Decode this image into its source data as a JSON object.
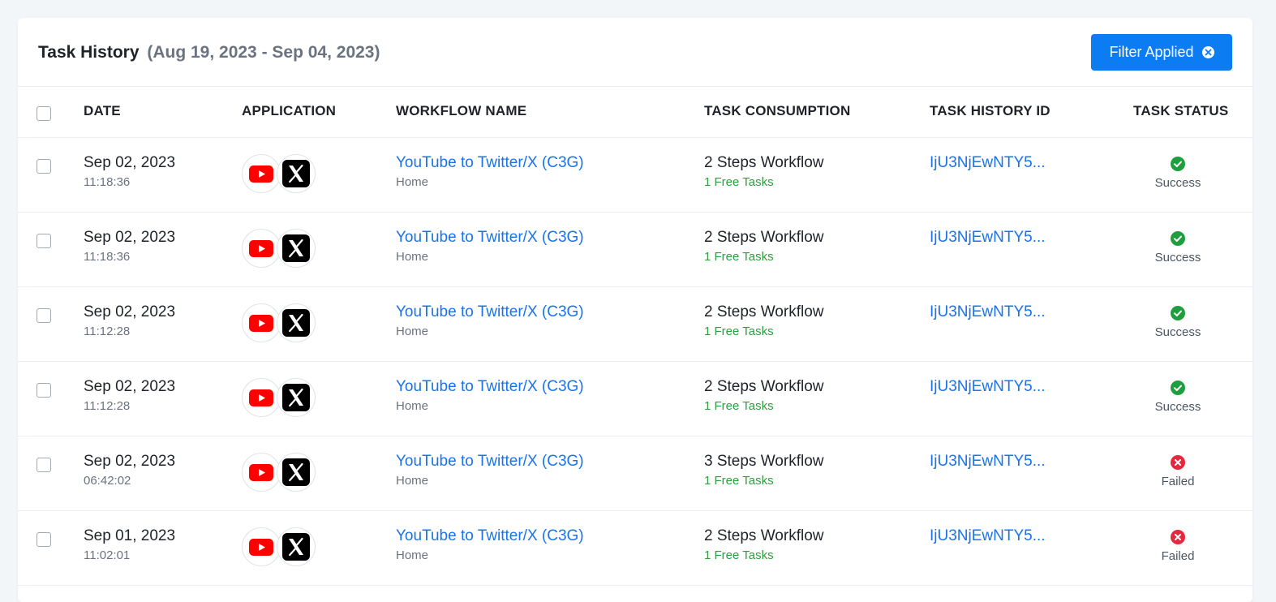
{
  "header": {
    "title": "Task History",
    "date_range": "(Aug 19, 2023 - Sep 04, 2023)",
    "filter_button_label": "Filter Applied"
  },
  "table": {
    "columns": {
      "date": "DATE",
      "application": "APPLICATION",
      "workflow_name": "WORKFLOW NAME",
      "task_consumption": "TASK CONSUMPTION",
      "task_history_id": "TASK HISTORY ID",
      "task_status": "TASK STATUS"
    },
    "rows": [
      {
        "date": "Sep 02, 2023",
        "time": "11:18:36",
        "workflow": "YouTube to Twitter/X (C3G)",
        "folder": "Home",
        "steps": "2 Steps Workflow",
        "tasks": "1 Free Tasks",
        "id": "IjU3NjEwNTY5...",
        "status": "Success"
      },
      {
        "date": "Sep 02, 2023",
        "time": "11:18:36",
        "workflow": "YouTube to Twitter/X (C3G)",
        "folder": "Home",
        "steps": "2 Steps Workflow",
        "tasks": "1 Free Tasks",
        "id": "IjU3NjEwNTY5...",
        "status": "Success"
      },
      {
        "date": "Sep 02, 2023",
        "time": "11:12:28",
        "workflow": "YouTube to Twitter/X (C3G)",
        "folder": "Home",
        "steps": "2 Steps Workflow",
        "tasks": "1 Free Tasks",
        "id": "IjU3NjEwNTY5...",
        "status": "Success"
      },
      {
        "date": "Sep 02, 2023",
        "time": "11:12:28",
        "workflow": "YouTube to Twitter/X (C3G)",
        "folder": "Home",
        "steps": "2 Steps Workflow",
        "tasks": "1 Free Tasks",
        "id": "IjU3NjEwNTY5...",
        "status": "Success"
      },
      {
        "date": "Sep 02, 2023",
        "time": "06:42:02",
        "workflow": "YouTube to Twitter/X (C3G)",
        "folder": "Home",
        "steps": "3 Steps Workflow",
        "tasks": "1 Free Tasks",
        "id": "IjU3NjEwNTY5...",
        "status": "Failed"
      },
      {
        "date": "Sep 01, 2023",
        "time": "11:02:01",
        "workflow": "YouTube to Twitter/X (C3G)",
        "folder": "Home",
        "steps": "2 Steps Workflow",
        "tasks": "1 Free Tasks",
        "id": "IjU3NjEwNTY5...",
        "status": "Failed"
      }
    ]
  },
  "icons": {
    "filter_clear": "close-circle-icon",
    "app_1": "youtube-icon",
    "app_2": "x-twitter-icon",
    "success": "check-circle-icon",
    "failed": "error-circle-icon"
  },
  "colors": {
    "primary_button": "#0c7cf2",
    "link": "#1a73e8",
    "free_tasks": "#2e9e3f",
    "success": "#1e9e3e",
    "failed": "#e5283e",
    "youtube_red": "#ff0000"
  }
}
